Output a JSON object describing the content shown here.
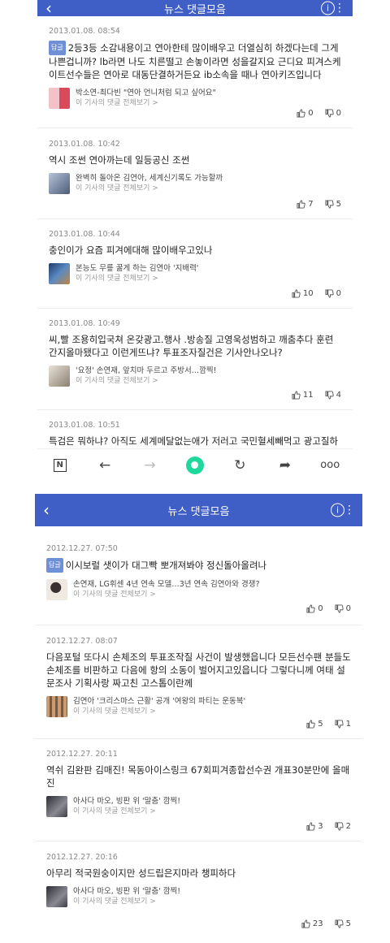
{
  "header": {
    "title": "뉴스 댓글모음",
    "back_icon": "chevron-left-icon",
    "info_icon": "info-icon",
    "more_icon": "more-vert-icon"
  },
  "labels": {
    "reply": "답글",
    "article_link": "이 기사의 댓글 전체보기 >"
  },
  "screen1": {
    "comments": [
      {
        "date": "2013.01.08. 08:54",
        "reply": true,
        "text": "2등3등 소감내용이고 연아한테 많이배우고 더열심히 하겠다는데 그게나쁜겁니까? lb라면 나도 치른떨고 손놓이라면 성을갈지요 근디요 피겨스케이트선수들은 연아로 대동단결하거든요 ib소속을 때나 연아키즈입니다",
        "article": "박소연-최다빈 \"연아 언니처럼 되고 싶어요\"",
        "thumb_color": "#e7c6c6",
        "likes": "0",
        "dislikes": "0"
      },
      {
        "date": "2013.01.08. 10:42",
        "reply": false,
        "text": "역시 조썬 연아까는데 일등공신 조썬",
        "article": "완벽히 돌아온 김연아, 세계신기록도 가능할까",
        "thumb_color": "#6a7c9a",
        "likes": "7",
        "dislikes": "5"
      },
      {
        "date": "2013.01.08. 10:44",
        "reply": false,
        "text": "충인이가 요즘 피겨에대해 많이배우고있나",
        "article": "본능도 무릎 꿇게 하는 김연아 '지배력'",
        "thumb_color": "#3a5d8a",
        "likes": "10",
        "dislikes": "0"
      },
      {
        "date": "2013.01.08. 10:49",
        "reply": false,
        "text": "씨,빨 조용히입국쳐 온갖광고.행사 .방송질 고영욱성범하고 깨춤추다 훈련간지올마됐다고 이런게뜨냐? 투표조자질건은 기사안나오나?",
        "article": "'요정' 손연재, 앞치마 두르고 주방서…깜찍!",
        "thumb_color": "#b9b2a6",
        "likes": "11",
        "dislikes": "4"
      },
      {
        "date": "2013.01.08. 10:51",
        "reply": false,
        "text": "특검은 뭐하냐? 아직도 세계메달없는애가 저러고 국민혈세빼먹고 광고질하는데"
      }
    ]
  },
  "screen2": {
    "comments": [
      {
        "date": "2012.12.27. 07:50",
        "reply": true,
        "text": "이시보럴 샛이가 대그빡 뽀개져봐야 정신돌아올려나",
        "article": "손연재, LG휘센 4년 연속 모델…3년 연속 김연아와 경쟁?",
        "thumb_color": "#d8d0c8",
        "likes": "0",
        "dislikes": "0"
      },
      {
        "date": "2012.12.27. 08:07",
        "reply": false,
        "text": "다음포털 또다시 손체조의 투표조작질 사건이 발생했읍니다 모든선수팬 분들도 손체조를 비판하고 다음에 항의 소동이 벌어지고있읍니다 그렇다니께 여태 설문조사 기획사랑 짜고친 고스톱이란께",
        "article": "김연아 '크리스마스 근황' 공개 '여왕의 파티는 운동복'",
        "thumb_color": "#b08a6a",
        "likes": "5",
        "dislikes": "1"
      },
      {
        "date": "2012.12.27. 20:11",
        "reply": false,
        "text": "역쉬 김완판 김매진! 목동아이스링크 67회피겨종합선수권 개표30분만에 올매진",
        "article": "아사다 마오, 빙판 위 '말춤' 깜찍!",
        "thumb_color": "#4a4a52",
        "likes": "3",
        "dislikes": "2"
      },
      {
        "date": "2012.12.27. 20:16",
        "reply": false,
        "text": "아무리 적국원숭이지만 성드립은지마라 챙피하다",
        "article": "아사다 마오, 빙판 위 '말춤' 깜찍!",
        "thumb_color": "#4a4a52",
        "likes": "23",
        "dislikes": "5"
      }
    ]
  },
  "navbar": {
    "icons": [
      "naver-n-icon",
      "back-arrow-icon",
      "forward-arrow-icon",
      "green-dot-icon",
      "refresh-icon",
      "share-icon",
      "more-dots-icon"
    ]
  }
}
